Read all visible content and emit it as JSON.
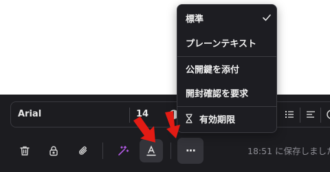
{
  "format_bar": {
    "font_family": "Arial",
    "font_size": "14"
  },
  "toolbar": {
    "buttons": [
      {
        "name": "delete",
        "icon": "trash-icon"
      },
      {
        "name": "lock",
        "icon": "lock-icon"
      },
      {
        "name": "attach",
        "icon": "paperclip-icon"
      },
      {
        "name": "magic",
        "icon": "magic-wand-icon"
      },
      {
        "name": "text-format",
        "icon": "text-color-icon"
      },
      {
        "name": "more",
        "icon": "more-horizontal-icon"
      }
    ],
    "more_label": "···",
    "saved_status": "18:51 に保存しました"
  },
  "menu": {
    "items": [
      {
        "label": "標準",
        "checked": true
      },
      {
        "label": "プレーンテキスト"
      },
      {
        "label": "公開鍵を添付"
      },
      {
        "label": "開封確認を要求"
      },
      {
        "label": "有効期限",
        "icon": "hourglass-icon"
      }
    ]
  },
  "colors": {
    "panel_bg": "#1c1c20",
    "menu_bg": "#1d1d22",
    "magic_accent": "#b35be6",
    "arrow_red": "#e31b14"
  }
}
